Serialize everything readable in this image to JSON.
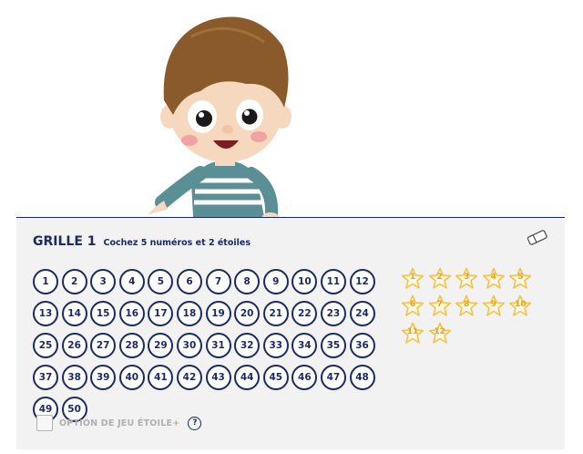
{
  "mascot": {
    "description_icon": "boy-pointing-icon"
  },
  "grid": {
    "title": "GRILLE 1",
    "hint": "Cochez 5 numéros et 2 étoiles",
    "eraser_icon": "eraser-icon",
    "numbers": [
      "1",
      "2",
      "3",
      "4",
      "5",
      "6",
      "7",
      "8",
      "9",
      "10",
      "11",
      "12",
      "13",
      "14",
      "15",
      "16",
      "17",
      "18",
      "19",
      "20",
      "21",
      "22",
      "23",
      "24",
      "25",
      "26",
      "27",
      "28",
      "29",
      "30",
      "31",
      "32",
      "33",
      "34",
      "35",
      "36",
      "37",
      "38",
      "39",
      "40",
      "41",
      "42",
      "43",
      "44",
      "45",
      "46",
      "47",
      "48",
      "49",
      "50"
    ],
    "stars": [
      "1",
      "2",
      "3",
      "4",
      "5",
      "6",
      "7",
      "8",
      "9",
      "10",
      "11",
      "12"
    ],
    "option_label": "OPTION DE JEU ÉTOILE+",
    "help_label": "?"
  },
  "colors": {
    "navy": "#1c2a63",
    "star": "#f2c14e",
    "card": "#f2f2f2"
  }
}
